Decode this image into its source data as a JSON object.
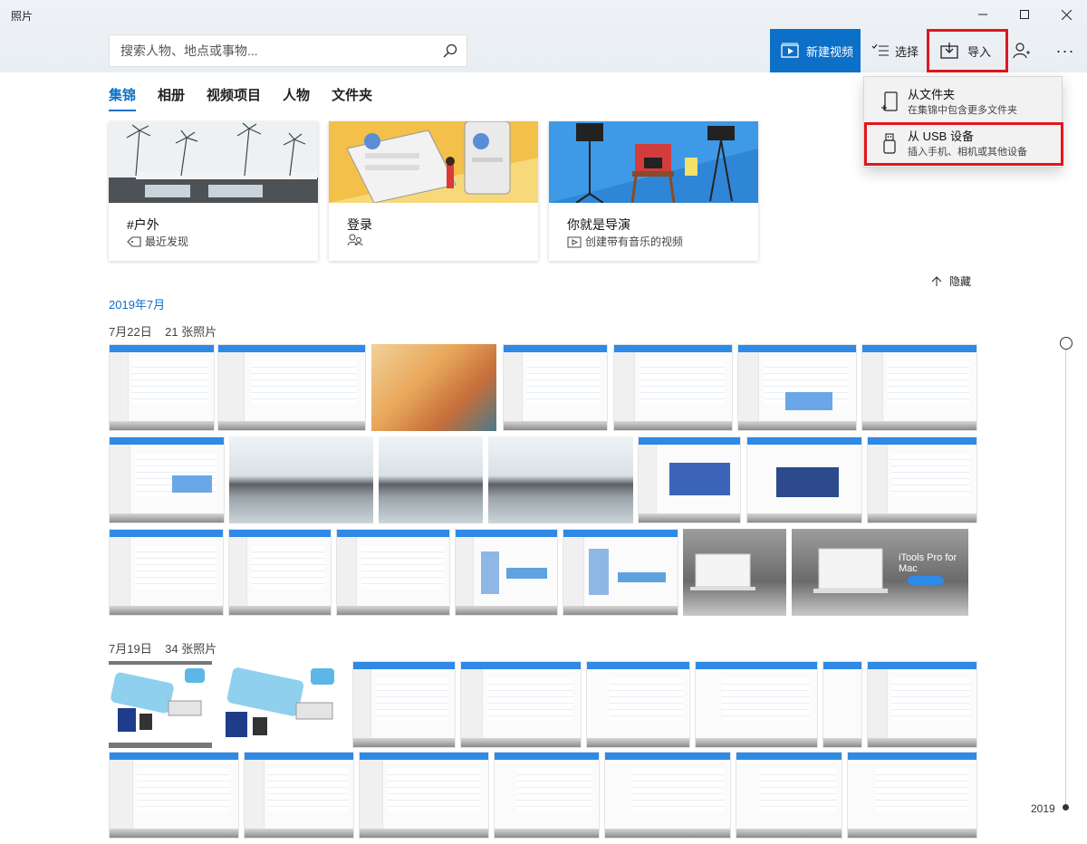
{
  "window": {
    "title": "照片",
    "minimize": "minimize",
    "maximize": "maximize",
    "close": "close"
  },
  "toolbar": {
    "search_placeholder": "搜索人物、地点或事物...",
    "new_video": "新建视频",
    "select": "选择",
    "import": "导入",
    "more": "···"
  },
  "import_menu": {
    "from_folder": {
      "title": "从文件夹",
      "subtitle": "在集锦中包含更多文件夹"
    },
    "from_usb": {
      "title": "从 USB 设备",
      "subtitle": "插入手机、相机或其他设备"
    }
  },
  "tabs": [
    {
      "label": "集锦",
      "active": true
    },
    {
      "label": "相册",
      "active": false
    },
    {
      "label": "视频项目",
      "active": false
    },
    {
      "label": "人物",
      "active": false
    },
    {
      "label": "文件夹",
      "active": false
    }
  ],
  "cards": [
    {
      "title": "#户外",
      "subtitle": "最近发现",
      "icon": "tag-icon"
    },
    {
      "title": "登录",
      "subtitle": "",
      "icon": "people-icon"
    },
    {
      "title": "你就是导演",
      "subtitle": "创建带有音乐的视频",
      "icon": "video-icon"
    }
  ],
  "hide_label": "隐藏",
  "month": "2019年7月",
  "groups": [
    {
      "date": "7月22日",
      "count": "21 张照片"
    },
    {
      "date": "7月19日",
      "count": "34 张照片"
    }
  ],
  "itools_caption": "iTools Pro for Mac",
  "timeline_year": "2019",
  "colors": {
    "accent": "#0c70c8",
    "highlight_red": "#e0171c"
  }
}
